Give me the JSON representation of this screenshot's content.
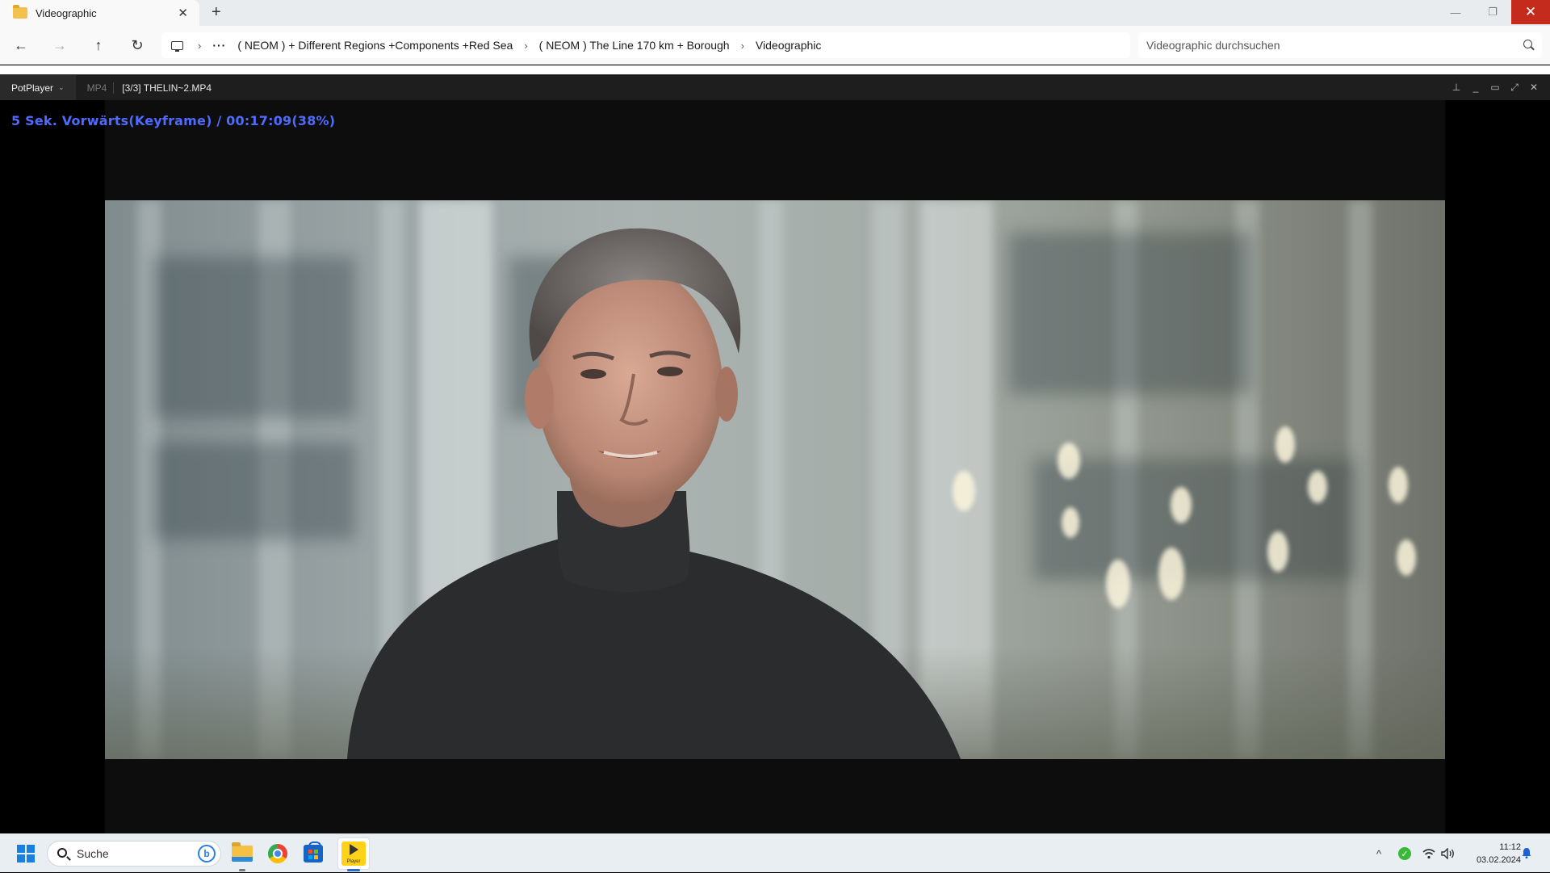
{
  "explorer": {
    "tab_title": "Videographic",
    "tab_close": "✕",
    "new_tab": "+",
    "window_controls": {
      "minimize": "—",
      "restore": "❐",
      "close": "✕"
    },
    "nav": {
      "back": "←",
      "forward": "→",
      "up": "↑",
      "refresh": "↻"
    },
    "breadcrumb": {
      "more": "···",
      "items": [
        "( NEOM ) + Different Regions +Components +Red Sea",
        "( NEOM ) The Line 170 km + Borough",
        "Videographic"
      ],
      "separator": "›"
    },
    "search_placeholder": "Videographic durchsuchen"
  },
  "potplayer": {
    "menu_label": "PotPlayer",
    "menu_chevron": "⌄",
    "format": "MP4",
    "file": "[3/3] THELIN~2.MP4",
    "controls": {
      "pin": "⊥",
      "minimize": "_",
      "maximize": "▭",
      "fullscreen": "⤢",
      "close": "✕"
    },
    "osd_text": "5  Sek. Vorwärts(Keyframe) / 00:17:09(38%)",
    "osd_color": "#4f6bff"
  },
  "taskbar": {
    "search_label": "Suche",
    "bing_label": "b",
    "pot_icon_text": "Player",
    "tray": {
      "chevron": "^",
      "shield_check": "✓",
      "wifi": "wifi-icon",
      "volume": "volume-icon"
    },
    "time": "11:12",
    "date": "03.02.2024"
  },
  "colors": {
    "close_red": "#c42b1c",
    "accent_blue": "#1b7fe0",
    "pot_yellow": "#ffd21a"
  }
}
